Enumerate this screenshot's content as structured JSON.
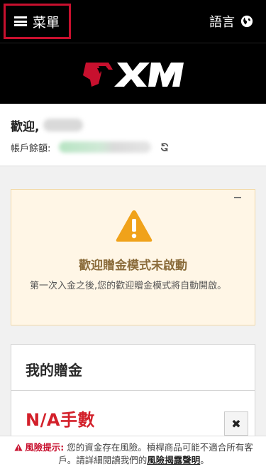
{
  "header": {
    "menu_label": "菜單",
    "language_label": "語言"
  },
  "brand": {
    "logo_text": "XM"
  },
  "account": {
    "welcome": "歡迎,",
    "balance_label": "帳戶餘額:"
  },
  "notice": {
    "title": "歡迎贈金模式未啟動",
    "body": "第一次入金之後,您的歡迎贈金模式將自動開啟。"
  },
  "bonus": {
    "title": "我的贈金",
    "lots_value": "N/A",
    "lots_unit": "手數"
  },
  "close_button_symbol": "✖",
  "risk": {
    "label": "風險提示:",
    "text": "您的資金存在風險。槓桿商品可能不適合所有客戶。請詳細閱讀我們的",
    "link": "風險揭露聲明",
    "end": "。"
  },
  "colors": {
    "brand_red": "#c8102e",
    "notice_bg": "#fff6e6",
    "warning_orange": "#f0a21a",
    "top_bar": "#000000"
  },
  "icons": [
    "hamburger-icon",
    "globe-icon",
    "refresh-icon",
    "warning-icon",
    "close-icon"
  ]
}
